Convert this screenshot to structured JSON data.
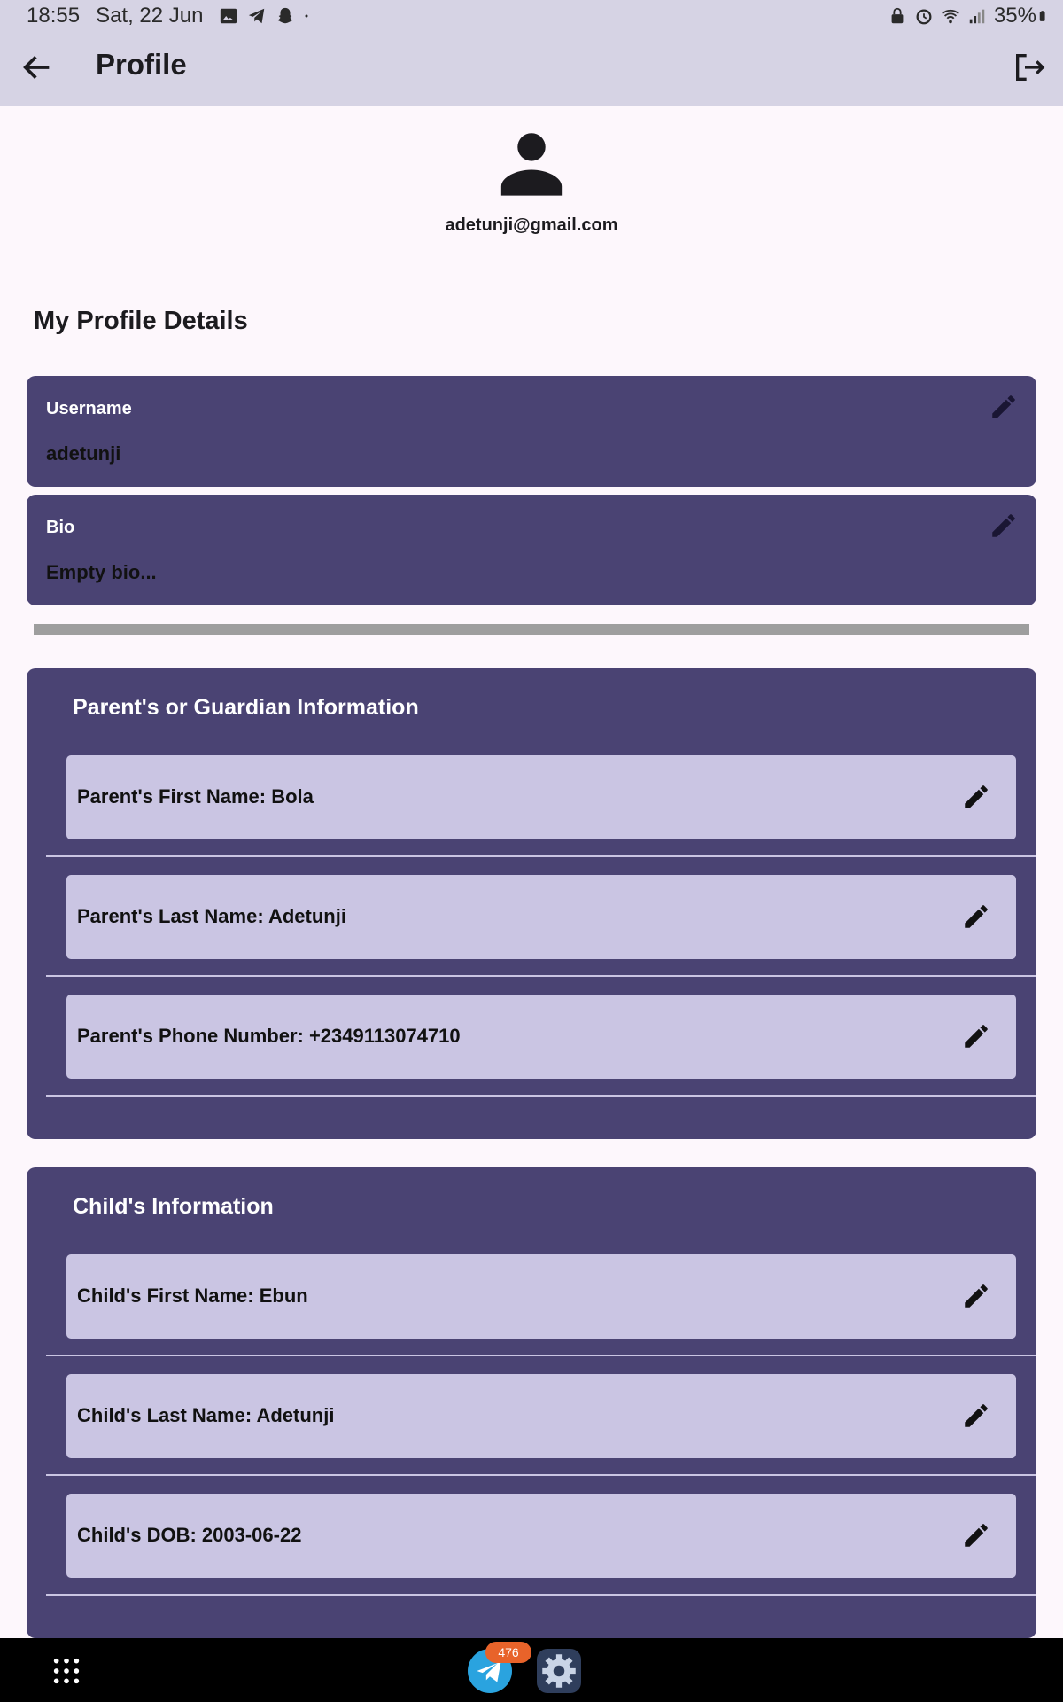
{
  "status_bar": {
    "time": "18:55",
    "date": "Sat, 22 Jun",
    "battery": "35%",
    "left_icons": [
      "gallery-icon",
      "telegram-icon",
      "snapchat-icon",
      "dot-icon"
    ],
    "right_icons": [
      "lock-icon",
      "alarm-icon",
      "wifi-icon",
      "signal-icon",
      "battery-icon"
    ]
  },
  "app_bar": {
    "title": "Profile",
    "back_icon": "arrow-back-icon",
    "logout_icon": "logout-icon"
  },
  "profile": {
    "avatar_icon": "person-icon",
    "email": "adetunji@gmail.com"
  },
  "details": {
    "section_title": "My Profile Details",
    "fields": [
      {
        "label": "Username",
        "value": "adetunji"
      },
      {
        "label": "Bio",
        "value": "Empty bio..."
      }
    ]
  },
  "parent_info": {
    "title": "Parent's or Guardian Information",
    "items": [
      "Parent's First Name: Bola",
      "Parent's Last Name: Adetunji",
      "Parent's Phone Number: +2349113074710"
    ]
  },
  "child_info": {
    "title": "Child's Information",
    "items": [
      "Child's First Name: Ebun",
      "Child's Last Name: Adetunji",
      "Child's DOB: 2003-06-22"
    ]
  },
  "nav_bar": {
    "telegram_badge": "476",
    "apps_icon": "apps-grid-icon",
    "telegram_icon": "telegram-icon",
    "settings_icon": "settings-icon"
  },
  "colors": {
    "card": "#4a4373",
    "row": "#cac5e3",
    "appbar": "#d6d3e4",
    "background": "#fdf7fc"
  }
}
